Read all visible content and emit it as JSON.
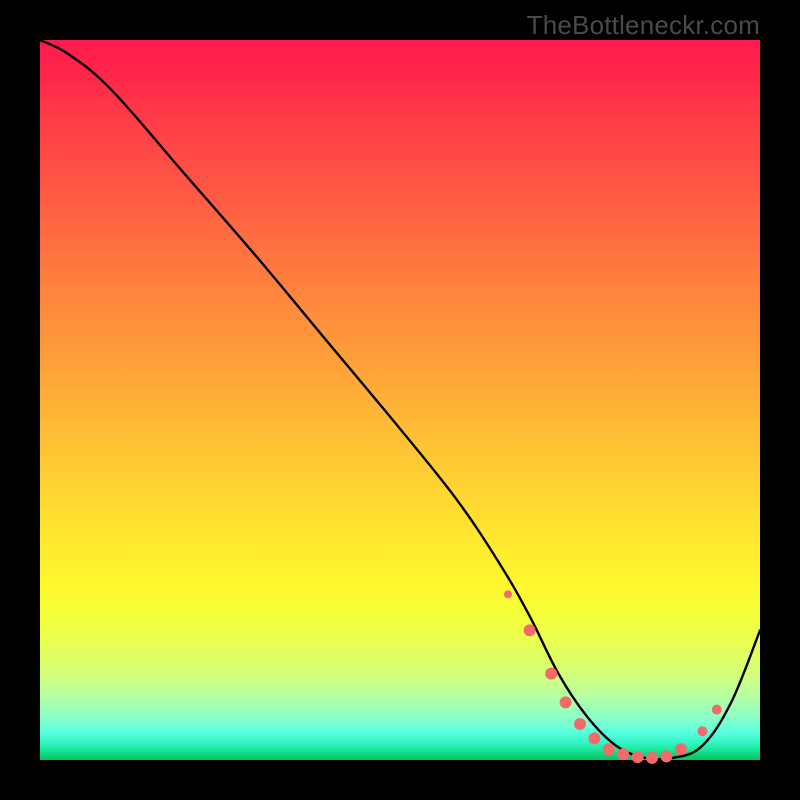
{
  "watermark": "TheBottleneckr.com",
  "chart_data": {
    "type": "line",
    "title": "",
    "xlabel": "",
    "ylabel": "",
    "xlim": [
      0,
      100
    ],
    "ylim": [
      0,
      100
    ],
    "grid": false,
    "legend": false,
    "series": [
      {
        "name": "curve",
        "x": [
          0,
          4,
          10,
          20,
          30,
          40,
          50,
          58,
          64,
          68,
          72,
          76,
          80,
          84,
          88,
          92,
          96,
          100
        ],
        "y": [
          100,
          98,
          93,
          81.5,
          70,
          58,
          46,
          36,
          27,
          20,
          12,
          6,
          2,
          0.3,
          0.3,
          2,
          8,
          18
        ],
        "color": "#000000"
      }
    ],
    "markers": [
      {
        "x": 65,
        "y": 23,
        "r": 4
      },
      {
        "x": 68,
        "y": 18,
        "r": 6
      },
      {
        "x": 71,
        "y": 12,
        "r": 6
      },
      {
        "x": 73,
        "y": 8,
        "r": 6
      },
      {
        "x": 75,
        "y": 5,
        "r": 6
      },
      {
        "x": 77,
        "y": 3,
        "r": 6
      },
      {
        "x": 79,
        "y": 1.5,
        "r": 6
      },
      {
        "x": 81,
        "y": 0.8,
        "r": 6
      },
      {
        "x": 83,
        "y": 0.4,
        "r": 6
      },
      {
        "x": 85,
        "y": 0.3,
        "r": 6
      },
      {
        "x": 87,
        "y": 0.5,
        "r": 6
      },
      {
        "x": 89,
        "y": 1.5,
        "r": 6
      },
      {
        "x": 92,
        "y": 4,
        "r": 5
      },
      {
        "x": 94,
        "y": 7,
        "r": 5
      }
    ],
    "marker_color": "#f46a6a"
  }
}
